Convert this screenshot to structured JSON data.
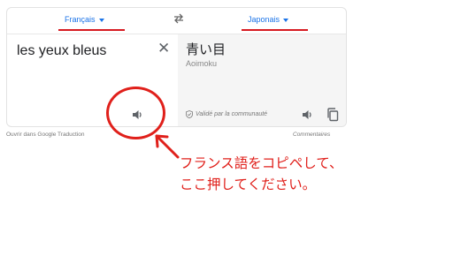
{
  "languages": {
    "source_label": "Français",
    "target_label": "Japonais"
  },
  "source": {
    "text": "les yeux bleus"
  },
  "target": {
    "text": "青い目",
    "romanization": "Aoimoku",
    "verified_label": "Validé par la communauté"
  },
  "footer": {
    "open_link": "Ouvrir dans Google Traduction",
    "feedback_link": "Commentaires"
  },
  "annotation": {
    "line1": "フランス語をコピペして、",
    "line2": "ここ押してください。",
    "color": "#e0201b"
  },
  "icons": {
    "swap": "swap-arrows-icon",
    "clear": "close-icon",
    "speaker": "speaker-icon",
    "copy": "copy-icon",
    "verified": "shield-check-icon"
  }
}
